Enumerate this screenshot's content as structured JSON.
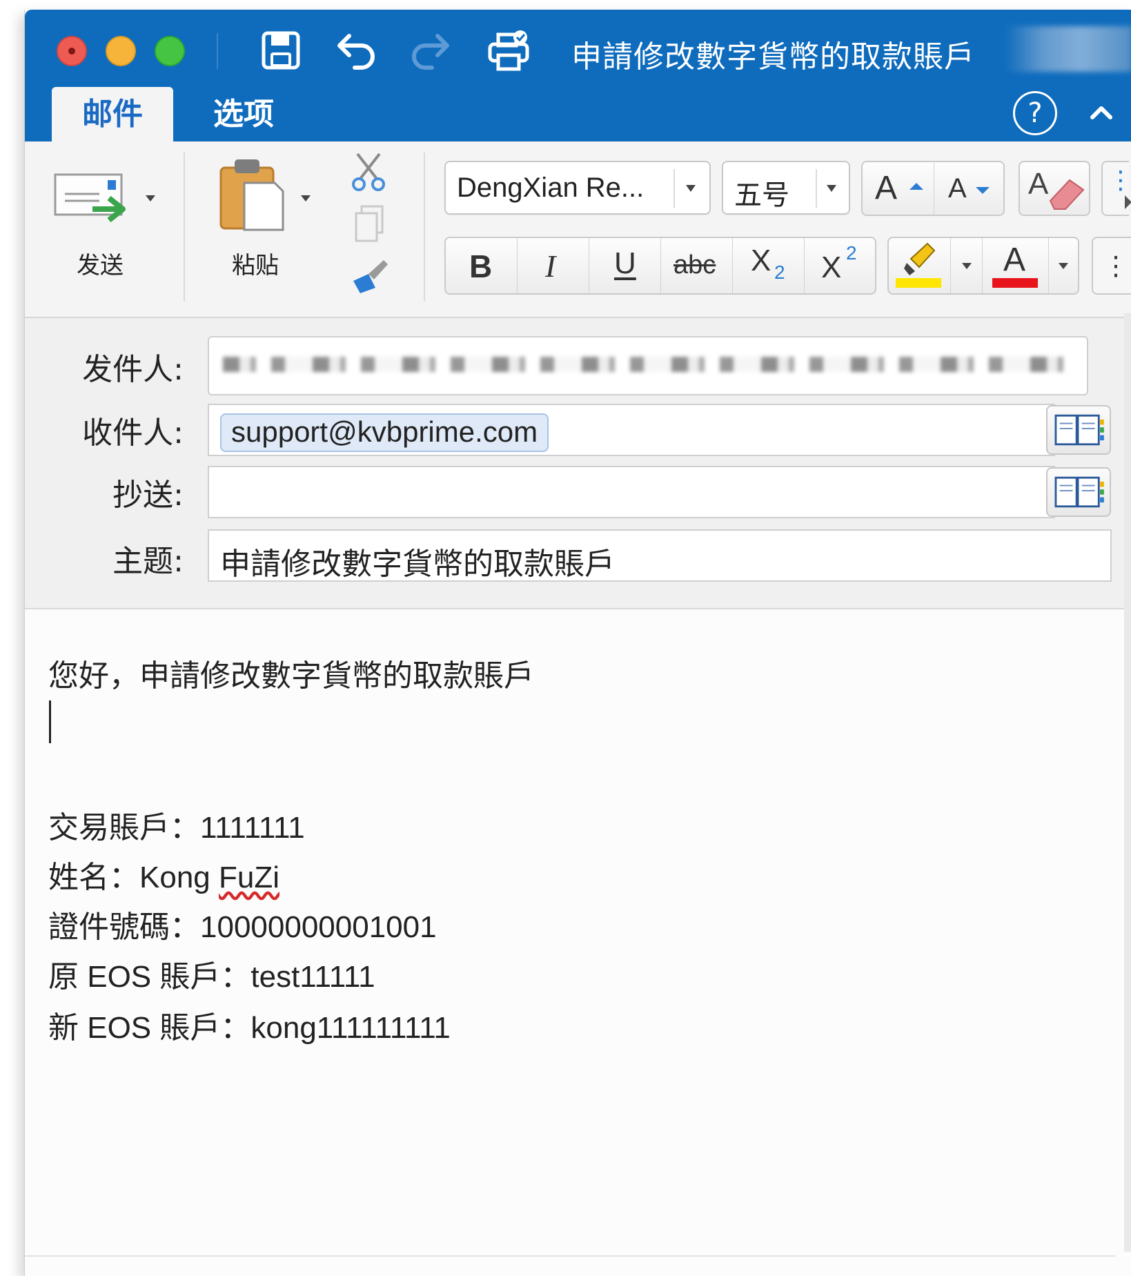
{
  "window": {
    "title": "申請修改數字貨幣的取款賬戶"
  },
  "tabs": {
    "mail": "邮件",
    "options": "选项"
  },
  "ribbon": {
    "send_label": "发送",
    "paste_label": "粘贴",
    "font_name": "DengXian Re...",
    "font_size": "五号",
    "bold": "B",
    "italic": "I",
    "underline": "U",
    "strikethrough": "abc",
    "subscript_base": "X",
    "subscript_mark": "2",
    "superscript_base": "X",
    "superscript_mark": "2",
    "grow_font": "A",
    "shrink_font": "A",
    "font_color_letter": "A",
    "highlight_color": "#ffe600",
    "font_color": "#e8141b"
  },
  "header": {
    "from_label": "发件人:",
    "to_label": "收件人:",
    "cc_label": "抄送:",
    "subject_label": "主题:",
    "to_recipient": "support@kvbprime.com",
    "cc_value": "",
    "subject_value": "申請修改數字貨幣的取款賬戶"
  },
  "body": {
    "greeting": "您好，申請修改數字貨幣的取款賬戶",
    "lines": [
      {
        "label": "交易賬戶：",
        "value": "1111111"
      },
      {
        "label": "姓名：",
        "value_a": "Kong ",
        "value_b": "FuZi"
      },
      {
        "label": "證件號碼：",
        "value": "10000000001001"
      },
      {
        "label": "原 EOS 賬戶：",
        "value": "test11111"
      },
      {
        "label": "新 EOS 賬戶：",
        "value": "kong111111111"
      }
    ]
  },
  "colors": {
    "titlebar": "#0f6cbd",
    "accent": "#1a6ac4"
  }
}
